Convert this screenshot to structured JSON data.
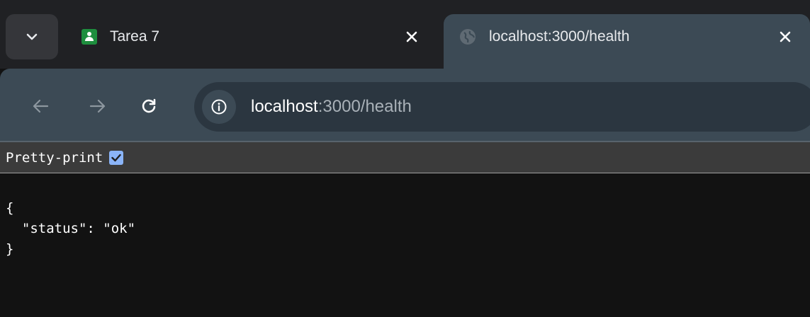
{
  "tabs": [
    {
      "title": "Tarea 7",
      "favicon": "google-classroom-icon",
      "active": false
    },
    {
      "title": "localhost:3000/health",
      "favicon": "globe-icon",
      "active": true
    }
  ],
  "omnibox": {
    "host": "localhost",
    "rest": ":3000/health"
  },
  "pretty_print": {
    "label": "Pretty-print",
    "checked": true
  },
  "json_body": {
    "open_brace": "{",
    "line": "  \"status\": \"ok\"",
    "close_brace": "}"
  },
  "colors": {
    "tab_strip": "#202124",
    "toolbar": "#3c4a55",
    "omnibox": "#2b3640",
    "page_background": "#121212",
    "checkbox_accent": "#8ab4f8"
  }
}
